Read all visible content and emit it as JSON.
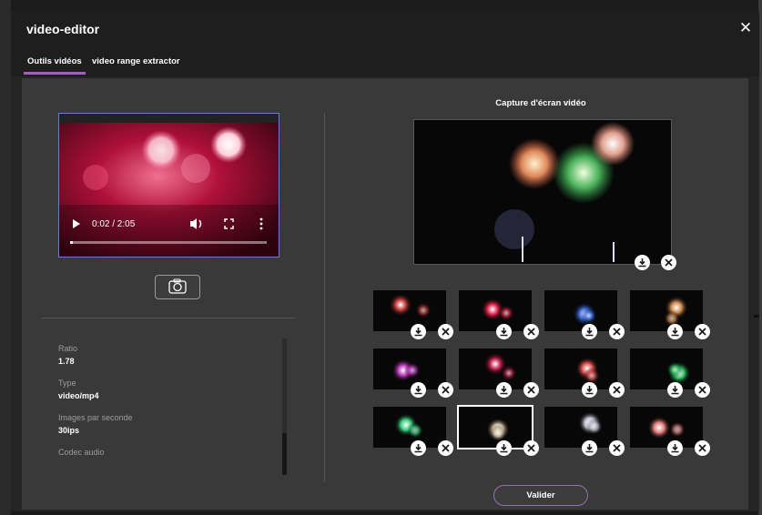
{
  "window": {
    "title": "video-editor",
    "close_glyph": "✕"
  },
  "tabs": [
    {
      "label": "Outils vidéos",
      "active": true
    },
    {
      "label": "video range extractor",
      "active": false
    }
  ],
  "player": {
    "time": "0:02 / 2:05",
    "progress": 0.016
  },
  "info": {
    "ratio_label": "Ratio",
    "ratio_value": "1.78",
    "type_label": "Type",
    "type_value": "video/mp4",
    "fps_label": "Images par seconde",
    "fps_value": "30ips",
    "audio_label": "Codec audio"
  },
  "capture": {
    "title": "Capture d'écran vidéo"
  },
  "thumbnails": {
    "count": 12,
    "selected_index": 9,
    "tints": [
      "#c23a3a",
      "#e0204a",
      "#3a6ae0",
      "#d08a50",
      "#c03ac0",
      "#c02050",
      "#e05050",
      "#2ac060",
      "#3ad080",
      "#d0c0a0",
      "#c0c0d0",
      "#e07a7a"
    ]
  },
  "actions": {
    "validate_label": "Valider"
  },
  "colors": {
    "accent": "#a65fc0",
    "panel": "#393939"
  }
}
